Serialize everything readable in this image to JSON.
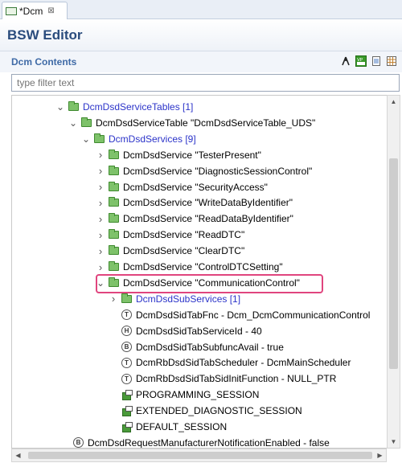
{
  "tab": {
    "label": "*Dcm",
    "close_glyph": "⊠"
  },
  "editor": {
    "title": "BSW Editor"
  },
  "section": {
    "title": "Dcm Contents",
    "icons": [
      "graph-icon",
      "vp-res-icon",
      "document-icon",
      "table-icon"
    ],
    "vp_res_label": "VP"
  },
  "filter": {
    "placeholder": "type filter text",
    "value": ""
  },
  "tree": {
    "rows": [
      {
        "depth": 0,
        "expand": "open",
        "icon": "folder",
        "label": "DcmDsdServiceTables [1]",
        "blue": true
      },
      {
        "depth": 1,
        "expand": "open",
        "icon": "folder",
        "label": "DcmDsdServiceTable \"DcmDsdServiceTable_UDS\"",
        "blue": false
      },
      {
        "depth": 2,
        "expand": "open",
        "icon": "folder",
        "label": "DcmDsdServices [9]",
        "blue": true
      },
      {
        "depth": 3,
        "expand": "closed",
        "icon": "folder",
        "label": "DcmDsdService \"TesterPresent\"",
        "blue": false
      },
      {
        "depth": 3,
        "expand": "closed",
        "icon": "folder",
        "label": "DcmDsdService \"DiagnosticSessionControl\"",
        "blue": false
      },
      {
        "depth": 3,
        "expand": "closed",
        "icon": "folder",
        "label": "DcmDsdService \"SecurityAccess\"",
        "blue": false
      },
      {
        "depth": 3,
        "expand": "closed",
        "icon": "folder",
        "label": "DcmDsdService \"WriteDataByIdentifier\"",
        "blue": false
      },
      {
        "depth": 3,
        "expand": "closed",
        "icon": "folder",
        "label": "DcmDsdService \"ReadDataByIdentifier\"",
        "blue": false
      },
      {
        "depth": 3,
        "expand": "closed",
        "icon": "folder",
        "label": "DcmDsdService \"ReadDTC\"",
        "blue": false
      },
      {
        "depth": 3,
        "expand": "closed",
        "icon": "folder",
        "label": "DcmDsdService \"ClearDTC\"",
        "blue": false
      },
      {
        "depth": 3,
        "expand": "closed",
        "icon": "folder",
        "label": "DcmDsdService \"ControlDTCSetting\"",
        "blue": false
      },
      {
        "depth": 3,
        "expand": "open",
        "icon": "folder",
        "label": "DcmDsdService \"CommunicationControl\"",
        "blue": false,
        "selected": true
      },
      {
        "depth": 4,
        "expand": "closed",
        "icon": "folder",
        "label": "DcmDsdSubServices [1]",
        "blue": true
      },
      {
        "depth": 4,
        "expand": "none",
        "icon": "param-T",
        "label": "DcmDsdSidTabFnc - Dcm_DcmCommunicationControl",
        "blue": false
      },
      {
        "depth": 4,
        "expand": "none",
        "icon": "param-H",
        "label": "DcmDsdSidTabServiceId - 40",
        "blue": false
      },
      {
        "depth": 4,
        "expand": "none",
        "icon": "param-B",
        "label": "DcmDsdSidTabSubfuncAvail - true",
        "blue": false
      },
      {
        "depth": 4,
        "expand": "none",
        "icon": "param-T",
        "label": "DcmRbDsdSidTabScheduler - DcmMainScheduler",
        "blue": false
      },
      {
        "depth": 4,
        "expand": "none",
        "icon": "param-T",
        "label": "DcmRbDsdSidTabSidInitFunction - NULL_PTR",
        "blue": false
      },
      {
        "depth": 4,
        "expand": "none",
        "icon": "reference",
        "label": "PROGRAMMING_SESSION",
        "blue": false
      },
      {
        "depth": 4,
        "expand": "none",
        "icon": "reference",
        "label": "EXTENDED_DIAGNOSTIC_SESSION",
        "blue": false
      },
      {
        "depth": 4,
        "expand": "none",
        "icon": "reference",
        "label": "DEFAULT_SESSION",
        "blue": false
      },
      {
        "depth": -1,
        "expand": "none",
        "icon": "param-B",
        "label": "DcmDsdRequestManufacturerNotificationEnabled - false",
        "blue": false
      }
    ]
  },
  "icon_letters": {
    "param-T": "T",
    "param-H": "H",
    "param-B": "B"
  },
  "colors": {
    "highlight_border": "#e0457e",
    "link_blue": "#2b33c9",
    "folder_green": "#7ec26a"
  }
}
